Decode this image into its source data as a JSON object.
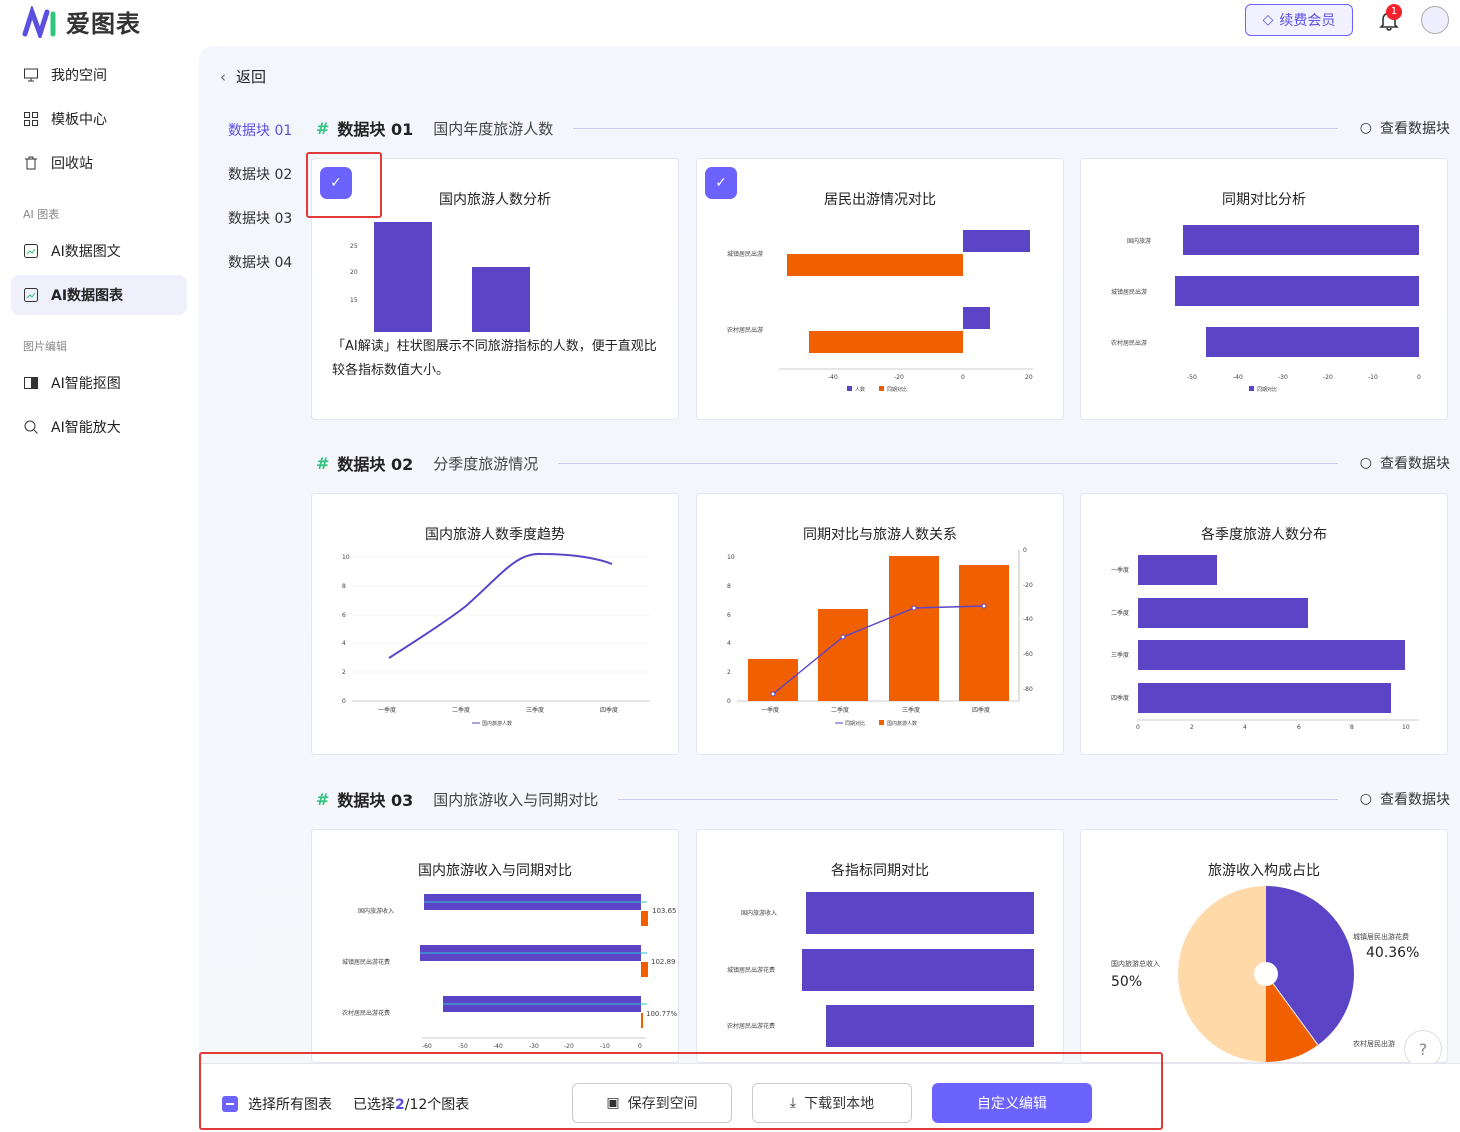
{
  "app": {
    "name": "爱图表",
    "vip_label": "续费会员",
    "notification_count": "1"
  },
  "sidebar": {
    "items": [
      {
        "label": "我的空间"
      },
      {
        "label": "模板中心"
      },
      {
        "label": "回收站"
      }
    ],
    "section_ai": "AI 图表",
    "ai_items": [
      {
        "label": "AI数据图文"
      },
      {
        "label": "AI数据图表"
      }
    ],
    "section_img": "图片编辑",
    "img_items": [
      {
        "label": "AI智能抠图"
      },
      {
        "label": "AI智能放大"
      }
    ]
  },
  "main": {
    "back_label": "返回",
    "block_nav": [
      "数据块 01",
      "数据块 02",
      "数据块 03",
      "数据块 04"
    ],
    "view_label": "查看数据块",
    "sections": [
      {
        "title": "数据块 01",
        "subtitle": "国内年度旅游人数"
      },
      {
        "title": "数据块 02",
        "subtitle": "分季度旅游情况"
      },
      {
        "title": "数据块 03",
        "subtitle": "国内旅游收入与同期对比"
      }
    ],
    "ai_reading": "「AI解读」柱状图展示不同旅游指标的人数，便于直观比较各指标数值大小。"
  },
  "charts": {
    "c1": {
      "title": "国内旅游人数分析"
    },
    "c2": {
      "title": "居民出游情况对比",
      "cats": [
        "城镇居民出游",
        "农村居民出游"
      ],
      "ticks": [
        "-40",
        "-20",
        "0",
        "20"
      ],
      "legend": [
        "人数",
        "同期对比"
      ]
    },
    "c3": {
      "title": "同期对比分析",
      "cats": [
        "国内旅游",
        "城镇居民出游",
        "农村居民出游"
      ],
      "ticks": [
        "-50",
        "-40",
        "-30",
        "-20",
        "-10",
        "0"
      ],
      "legend": [
        "同期对比"
      ]
    },
    "c4": {
      "title": "国内旅游人数季度趋势",
      "cats": [
        "一季度",
        "二季度",
        "三季度",
        "四季度"
      ],
      "yticks": [
        "0",
        "2",
        "4",
        "6",
        "8",
        "10"
      ],
      "legend": [
        "国内旅游人数"
      ]
    },
    "c5": {
      "title": "同期对比与旅游人数关系",
      "cats": [
        "一季度",
        "二季度",
        "三季度",
        "四季度"
      ],
      "yticks": [
        "0",
        "2",
        "4",
        "6",
        "8",
        "10"
      ],
      "y2ticks": [
        "0",
        "-20",
        "-40",
        "-60",
        "-80"
      ],
      "legend": [
        "同期对比",
        "国内旅游人数"
      ]
    },
    "c6": {
      "title": "各季度旅游人数分布",
      "cats": [
        "一季度",
        "二季度",
        "三季度",
        "四季度"
      ],
      "ticks": [
        "0",
        "2",
        "4",
        "6",
        "8",
        "10"
      ]
    },
    "c7": {
      "title": "国内旅游收入与同期对比",
      "cats": [
        "国内旅游收入",
        "城镇居民出游花费",
        "农村居民出游花费"
      ],
      "labels": [
        "103.65",
        "102.89",
        "100.77%"
      ],
      "ticks": [
        "-60",
        "-50",
        "-40",
        "-30",
        "-20",
        "-10",
        "0"
      ]
    },
    "c8": {
      "title": "各指标同期对比",
      "cats": [
        "国内旅游收入",
        "城镇居民出游花费",
        "农村居民出游花费"
      ]
    },
    "c9": {
      "title": "旅游收入构成占比",
      "labels": [
        "城镇居民出游花费",
        "国内旅游总收入",
        "农村居民出游"
      ],
      "values": [
        "40.36%",
        "50%"
      ]
    }
  },
  "chart_data": [
    {
      "type": "bar",
      "title": "国内旅游人数分析",
      "yticks": [
        15,
        20,
        25
      ],
      "values": [
        28,
        20
      ]
    },
    {
      "type": "bar",
      "title": "居民出游情况对比",
      "categories": [
        "城镇居民出游",
        "农村居民出游"
      ],
      "series": [
        {
          "name": "人数",
          "values": [
            20,
            8
          ]
        },
        {
          "name": "同期对比",
          "values": [
            -53,
            -47
          ]
        }
      ],
      "xlim": [
        -55,
        20
      ]
    },
    {
      "type": "bar",
      "title": "同期对比分析",
      "categories": [
        "国内旅游",
        "城镇居民出游",
        "农村居民出游"
      ],
      "series": [
        {
          "name": "同期对比",
          "values": [
            -52,
            -54,
            -47
          ]
        }
      ],
      "xlim": [
        -50,
        0
      ]
    },
    {
      "type": "line",
      "title": "国内旅游人数季度趋势",
      "categories": [
        "一季度",
        "二季度",
        "三季度",
        "四季度"
      ],
      "series": [
        {
          "name": "国内旅游人数",
          "values": [
            3,
            6.5,
            10.2,
            9.5
          ]
        }
      ],
      "ylim": [
        0,
        10
      ]
    },
    {
      "type": "bar",
      "title": "同期对比与旅游人数关系",
      "categories": [
        "一季度",
        "二季度",
        "三季度",
        "四季度"
      ],
      "series": [
        {
          "name": "国内旅游人数",
          "values": [
            3,
            6.5,
            10,
            9.5
          ]
        },
        {
          "name": "同期对比",
          "values": [
            -83,
            -50,
            -33,
            -32
          ]
        }
      ],
      "ylim": [
        0,
        10
      ],
      "y2lim": [
        -88,
        0
      ]
    },
    {
      "type": "bar",
      "title": "各季度旅游人数分布",
      "categories": [
        "一季度",
        "二季度",
        "三季度",
        "四季度"
      ],
      "values": [
        3,
        6.4,
        10,
        9.5
      ],
      "xlim": [
        0,
        10
      ]
    },
    {
      "type": "bar",
      "title": "国内旅游收入与同期对比",
      "categories": [
        "国内旅游收入",
        "城镇居民出游花费",
        "农村居民出游花费"
      ],
      "labels": [
        "103.65",
        "102.89",
        "100.77%"
      ]
    },
    {
      "type": "bar",
      "title": "各指标同期对比",
      "categories": [
        "国内旅游收入",
        "城镇居民出游花费",
        "农村居民出游花费"
      ]
    },
    {
      "type": "pie",
      "title": "旅游收入构成占比",
      "labels": [
        "城镇居民出游花费",
        "农村居民出游",
        "国内旅游总收入"
      ],
      "values": [
        40.36,
        9.64,
        50
      ]
    }
  ],
  "bottom": {
    "select_all": "选择所有图表",
    "selected_prefix": "已选择",
    "selected_count": "2",
    "selected_suffix": "/12个图表",
    "save_label": "保存到空间",
    "download_label": "下载到本地",
    "edit_label": "自定义编辑"
  },
  "colors": {
    "accent": "#6c63ff",
    "bar_purple": "#5b44c6",
    "bar_orange": "#f06000",
    "pie_peach": "#ffd9a8"
  }
}
